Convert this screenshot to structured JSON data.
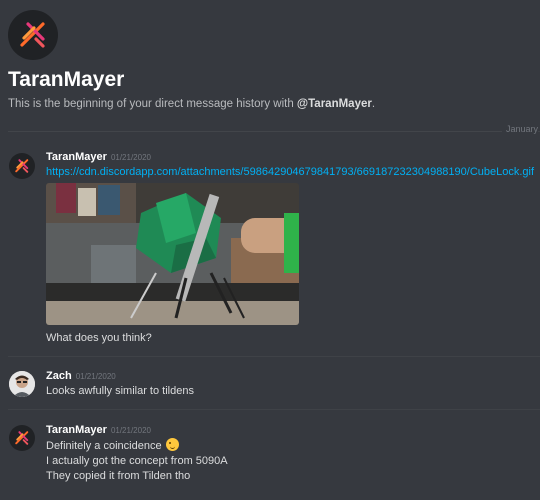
{
  "header": {
    "title": "TaranMayer",
    "intro_text": "This is the beginning of your direct message history with ",
    "intro_user": "@TaranMayer",
    "intro_end": "."
  },
  "divider": {
    "label": "January"
  },
  "messages": [
    {
      "username": "TaranMayer",
      "timestamp": "01/21/2020",
      "link": "https://cdn.discordapp.com/attachments/598642904679841793/669187232304988190/CubeLock.gif",
      "text": "What does you think?",
      "avatar": "taran-logo-icon"
    },
    {
      "username": "Zach",
      "timestamp": "01/21/2020",
      "text": "Looks awfully similar to tildens",
      "avatar": "zach-avatar"
    },
    {
      "username": "TaranMayer",
      "timestamp": "01/21/2020",
      "lines": [
        "Definitely a coincidence",
        "I actually got the concept from 5090A",
        "They copied it from Tilden tho"
      ],
      "emoji": "winking-face-emoji",
      "avatar": "taran-logo-icon"
    }
  ],
  "colors": {
    "background": "#36393f",
    "link": "#00b0f4",
    "logo_orange": "#ff6a2a",
    "logo_pink": "#e8387a"
  }
}
